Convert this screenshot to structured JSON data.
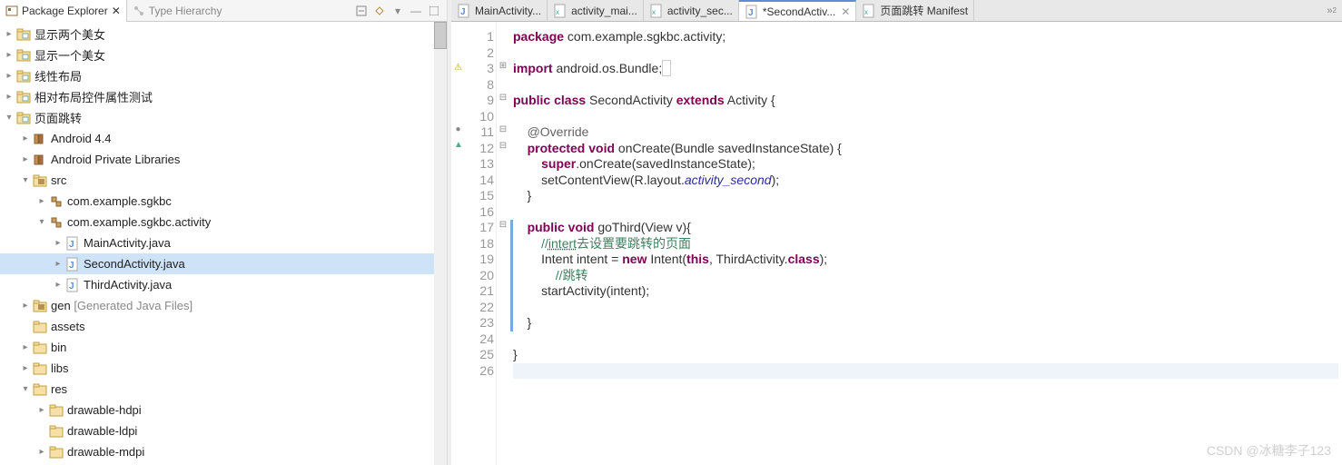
{
  "package_explorer": {
    "title": "Package Explorer",
    "secondary_tab": "Type Hierarchy",
    "items": [
      {
        "indent": 0,
        "arrow": "closed",
        "icon": "proj",
        "label": "显示两个美女"
      },
      {
        "indent": 0,
        "arrow": "closed",
        "icon": "proj",
        "label": "显示一个美女"
      },
      {
        "indent": 0,
        "arrow": "closed",
        "icon": "proj",
        "label": "线性布局"
      },
      {
        "indent": 0,
        "arrow": "closed",
        "icon": "proj",
        "label": "相对布局控件属性测试"
      },
      {
        "indent": 0,
        "arrow": "open",
        "icon": "proj",
        "label": "页面跳转"
      },
      {
        "indent": 1,
        "arrow": "closed",
        "icon": "lib",
        "label": "Android 4.4"
      },
      {
        "indent": 1,
        "arrow": "closed",
        "icon": "lib",
        "label": "Android Private Libraries"
      },
      {
        "indent": 1,
        "arrow": "open",
        "icon": "srcfolder",
        "label": "src"
      },
      {
        "indent": 2,
        "arrow": "closed",
        "icon": "pkg",
        "label": "com.example.sgkbc"
      },
      {
        "indent": 2,
        "arrow": "open",
        "icon": "pkg",
        "label": "com.example.sgkbc.activity"
      },
      {
        "indent": 3,
        "arrow": "closed",
        "icon": "java",
        "label": "MainActivity.java"
      },
      {
        "indent": 3,
        "arrow": "closed",
        "icon": "java",
        "label": "SecondActivity.java",
        "selected": true
      },
      {
        "indent": 3,
        "arrow": "closed",
        "icon": "java",
        "label": "ThirdActivity.java"
      },
      {
        "indent": 1,
        "arrow": "closed",
        "icon": "srcfolder",
        "label": "gen ",
        "extra": "[Generated Java Files]"
      },
      {
        "indent": 1,
        "arrow": "none",
        "icon": "folder",
        "label": "assets"
      },
      {
        "indent": 1,
        "arrow": "closed",
        "icon": "folder",
        "label": "bin"
      },
      {
        "indent": 1,
        "arrow": "closed",
        "icon": "folder",
        "label": "libs"
      },
      {
        "indent": 1,
        "arrow": "open",
        "icon": "folder",
        "label": "res"
      },
      {
        "indent": 2,
        "arrow": "closed",
        "icon": "folder",
        "label": "drawable-hdpi"
      },
      {
        "indent": 2,
        "arrow": "none",
        "icon": "folder",
        "label": "drawable-ldpi"
      },
      {
        "indent": 2,
        "arrow": "closed",
        "icon": "folder",
        "label": "drawable-mdpi"
      }
    ]
  },
  "editor": {
    "tabs": [
      {
        "icon": "java",
        "label": "MainActivity..."
      },
      {
        "icon": "xml",
        "label": "activity_mai..."
      },
      {
        "icon": "xml",
        "label": "activity_sec..."
      },
      {
        "icon": "java",
        "label": "*SecondActiv...",
        "active": true,
        "closable": true
      },
      {
        "icon": "xml",
        "label": "页面跳转 Manifest"
      }
    ],
    "gutter": [
      "1",
      "2",
      "3",
      "8",
      "9",
      "10",
      "11",
      "12",
      "13",
      "14",
      "15",
      "16",
      "17",
      "18",
      "19",
      "20",
      "21",
      "22",
      "23",
      "24",
      "25",
      "26"
    ],
    "code_lines": [
      {
        "html": "<span class='kw'>package</span> com.example.sgkbc.activity;"
      },
      {
        "html": " "
      },
      {
        "html": "<span class='kw'>import</span> android.os.Bundle;<span style='border:1px solid #ccc;color:#ccc;padding:0 2px'> </span>"
      },
      {
        "html": " "
      },
      {
        "html": "<span class='kw'>public class</span> SecondActivity <span class='kw'>extends</span> Activity {"
      },
      {
        "html": " "
      },
      {
        "html": "    <span class='ann'>@Override</span>"
      },
      {
        "html": "    <span class='kw'>protected void</span> onCreate(Bundle savedInstanceState) {"
      },
      {
        "html": "        <span class='kw'>super</span>.onCreate(savedInstanceState);"
      },
      {
        "html": "        setContentView(R.layout.<span class='it'>activity_second</span>);"
      },
      {
        "html": "    }"
      },
      {
        "html": " "
      },
      {
        "html": "    <span class='kw'>public void</span> goThird(View v){",
        "hl": true
      },
      {
        "html": "        <span class='cmt'>//<span class='dotted'>intert</span>去设置要跳转的页面</span>",
        "hl": true
      },
      {
        "html": "        Intent intent = <span class='kw'>new</span> Intent(<span class='kw'>this</span>, ThirdActivity.<span class='kw'>class</span>);",
        "hl": true
      },
      {
        "html": "            <span class='cmt'>//跳转</span>",
        "hl": true
      },
      {
        "html": "        startActivity(intent);",
        "hl": true
      },
      {
        "html": " ",
        "hl": true
      },
      {
        "html": "    }",
        "hl": true
      },
      {
        "html": " "
      },
      {
        "html": "}"
      },
      {
        "html": " ",
        "current": true
      }
    ],
    "markers": {
      "2": "warn",
      "6": "circle",
      "7": "arrow"
    },
    "fold": {
      "2": "plus",
      "4": "minus",
      "6": "minus",
      "7": "minus",
      "12": "minus"
    }
  },
  "watermark": "CSDN @冰糖李子123"
}
